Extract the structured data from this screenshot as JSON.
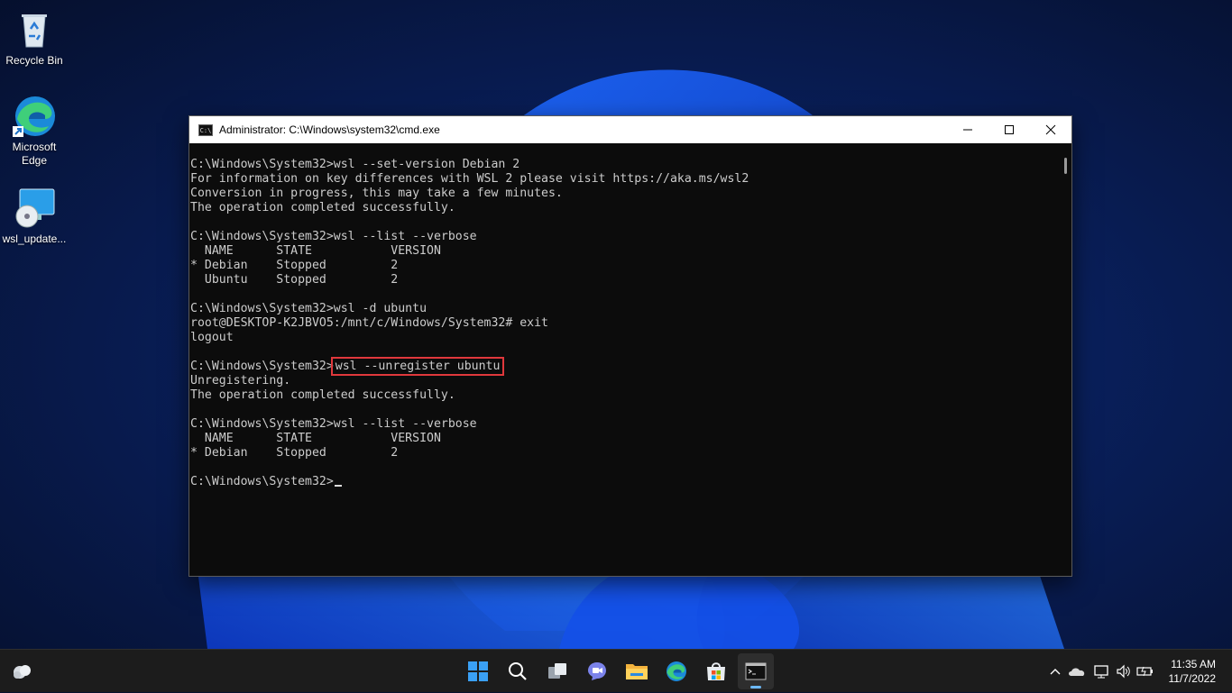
{
  "desktop": {
    "icons": [
      {
        "label": "Recycle Bin",
        "icon": "recycle-bin-icon"
      },
      {
        "label": "Microsoft Edge",
        "icon": "edge-icon"
      },
      {
        "label": "wsl_update...",
        "icon": "installer-icon"
      }
    ]
  },
  "window": {
    "title": "Administrator: C:\\Windows\\system32\\cmd.exe",
    "app_icon_text": "C:\\",
    "controls": [
      "minimize",
      "maximize",
      "close"
    ]
  },
  "console": {
    "lines": [
      "C:\\Windows\\System32>wsl --set-version Debian 2",
      "For information on key differences with WSL 2 please visit https://aka.ms/wsl2",
      "Conversion in progress, this may take a few minutes.",
      "The operation completed successfully.",
      "",
      "C:\\Windows\\System32>wsl --list --verbose",
      "  NAME      STATE           VERSION",
      "* Debian    Stopped         2",
      "  Ubuntu    Stopped         2",
      "",
      "C:\\Windows\\System32>wsl -d ubuntu",
      "root@DESKTOP-K2JBVO5:/mnt/c/Windows/System32# exit",
      "logout",
      ""
    ],
    "highlight_prompt": "C:\\Windows\\System32>",
    "highlight_command": "wsl --unregister ubuntu",
    "lines_after": [
      "Unregistering.",
      "The operation completed successfully.",
      "",
      "C:\\Windows\\System32>wsl --list --verbose",
      "  NAME      STATE           VERSION",
      "* Debian    Stopped         2",
      ""
    ],
    "final_prompt": "C:\\Windows\\System32>"
  },
  "taskbar": {
    "apps": [
      "widgets-icon",
      "start-icon",
      "search-icon",
      "task-view-icon",
      "chat-icon",
      "file-explorer-icon",
      "edge-icon",
      "store-icon",
      "terminal-icon"
    ],
    "clock_time": "11:35 AM",
    "clock_date": "11/7/2022"
  },
  "colors": {
    "console_bg": "#0c0c0c",
    "console_fg": "#cccccc",
    "highlight": "#e0383c",
    "taskbar": "#1c1c1c"
  }
}
